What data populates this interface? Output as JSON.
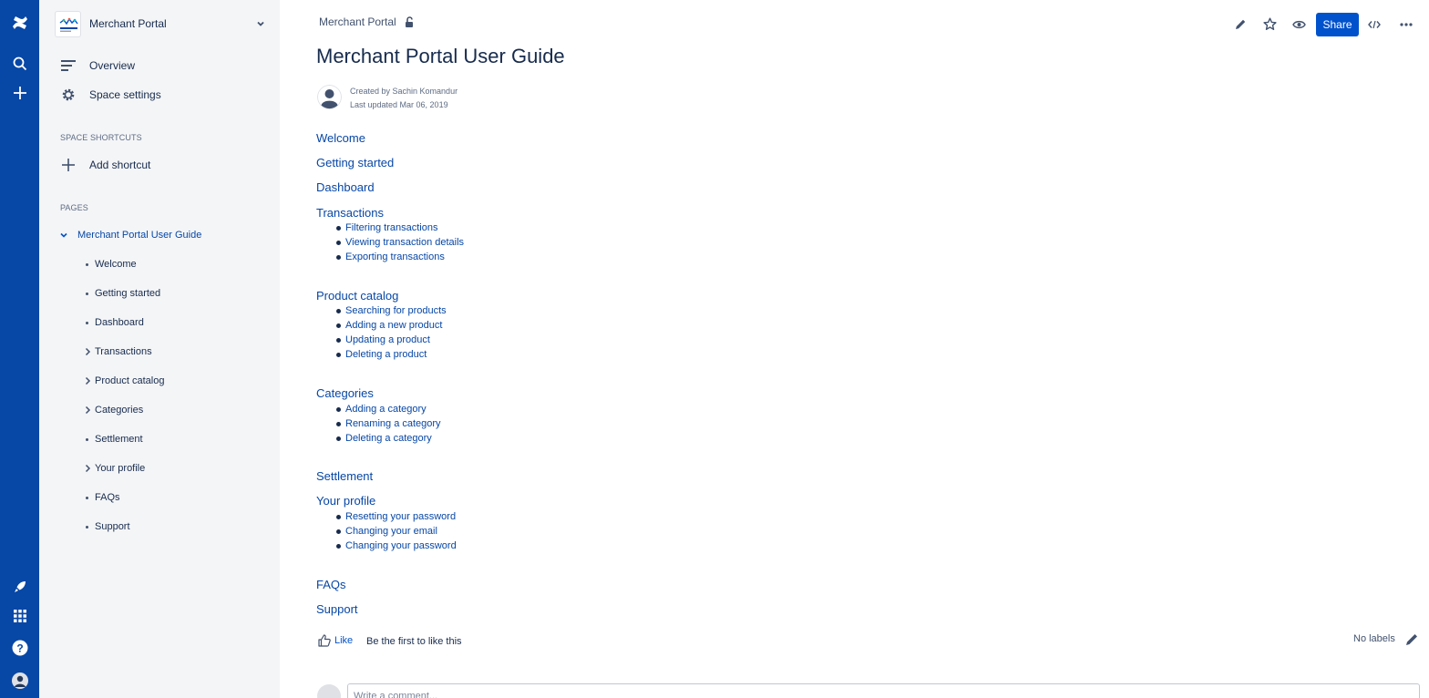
{
  "nav_rail": {
    "top_icons": [
      "confluence-logo-icon",
      "search-icon",
      "create-icon"
    ],
    "bottom_icons": [
      "rocket-icon",
      "app-switcher-icon",
      "help-icon",
      "profile-icon"
    ]
  },
  "sidebar": {
    "space_name": "Merchant Portal",
    "overview_label": "Overview",
    "space_settings_label": "Space settings",
    "shortcuts_heading": "SPACE SHORTCUTS",
    "add_shortcut_label": "Add shortcut",
    "pages_heading": "PAGES",
    "tree_root": "Merchant Portal User Guide",
    "tree_items": [
      {
        "label": "Welcome",
        "expandable": false
      },
      {
        "label": "Getting started",
        "expandable": false
      },
      {
        "label": "Dashboard",
        "expandable": false
      },
      {
        "label": "Transactions",
        "expandable": true
      },
      {
        "label": "Product catalog",
        "expandable": true
      },
      {
        "label": "Categories",
        "expandable": true
      },
      {
        "label": "Settlement",
        "expandable": false
      },
      {
        "label": "Your profile",
        "expandable": true
      },
      {
        "label": "FAQs",
        "expandable": false
      },
      {
        "label": "Support",
        "expandable": false
      }
    ]
  },
  "header": {
    "breadcrumb": "Merchant Portal",
    "share_label": "Share",
    "toolbar_icons": [
      "edit-icon",
      "star-icon",
      "watch-icon",
      "share-button",
      "embed-code-icon",
      "more-icon"
    ]
  },
  "page": {
    "title": "Merchant Portal User Guide",
    "created_by": "Created by Sachin Komandur",
    "last_updated": "Last updated Mar 06, 2019",
    "sections": [
      {
        "title": "Welcome",
        "items": []
      },
      {
        "title": "Getting started",
        "items": []
      },
      {
        "title": "Dashboard",
        "items": []
      },
      {
        "title": "Transactions",
        "items": [
          "Filtering transactions",
          "Viewing transaction details",
          "Exporting transactions"
        ]
      },
      {
        "title": "Product catalog",
        "items": [
          "Searching for products",
          "Adding a new product",
          "Updating a product",
          "Deleting a product"
        ]
      },
      {
        "title": "Categories",
        "items": [
          "Adding a category",
          "Renaming a category",
          "Deleting a category"
        ]
      },
      {
        "title": "Settlement",
        "items": []
      },
      {
        "title": "Your profile",
        "items": [
          "Resetting your password",
          "Changing your email",
          "Changing your password"
        ]
      },
      {
        "title": "FAQs",
        "items": []
      },
      {
        "title": "Support",
        "items": []
      }
    ],
    "like_label": "Like",
    "like_text": "Be the first to like this",
    "labels_text": "No labels",
    "comment_placeholder": "Write a comment..."
  },
  "colors": {
    "rail": "#0747a6",
    "sidebar": "#f4f5f7",
    "link": "#0747a6",
    "primary_button": "#0052cc",
    "text": "#172b4d"
  }
}
